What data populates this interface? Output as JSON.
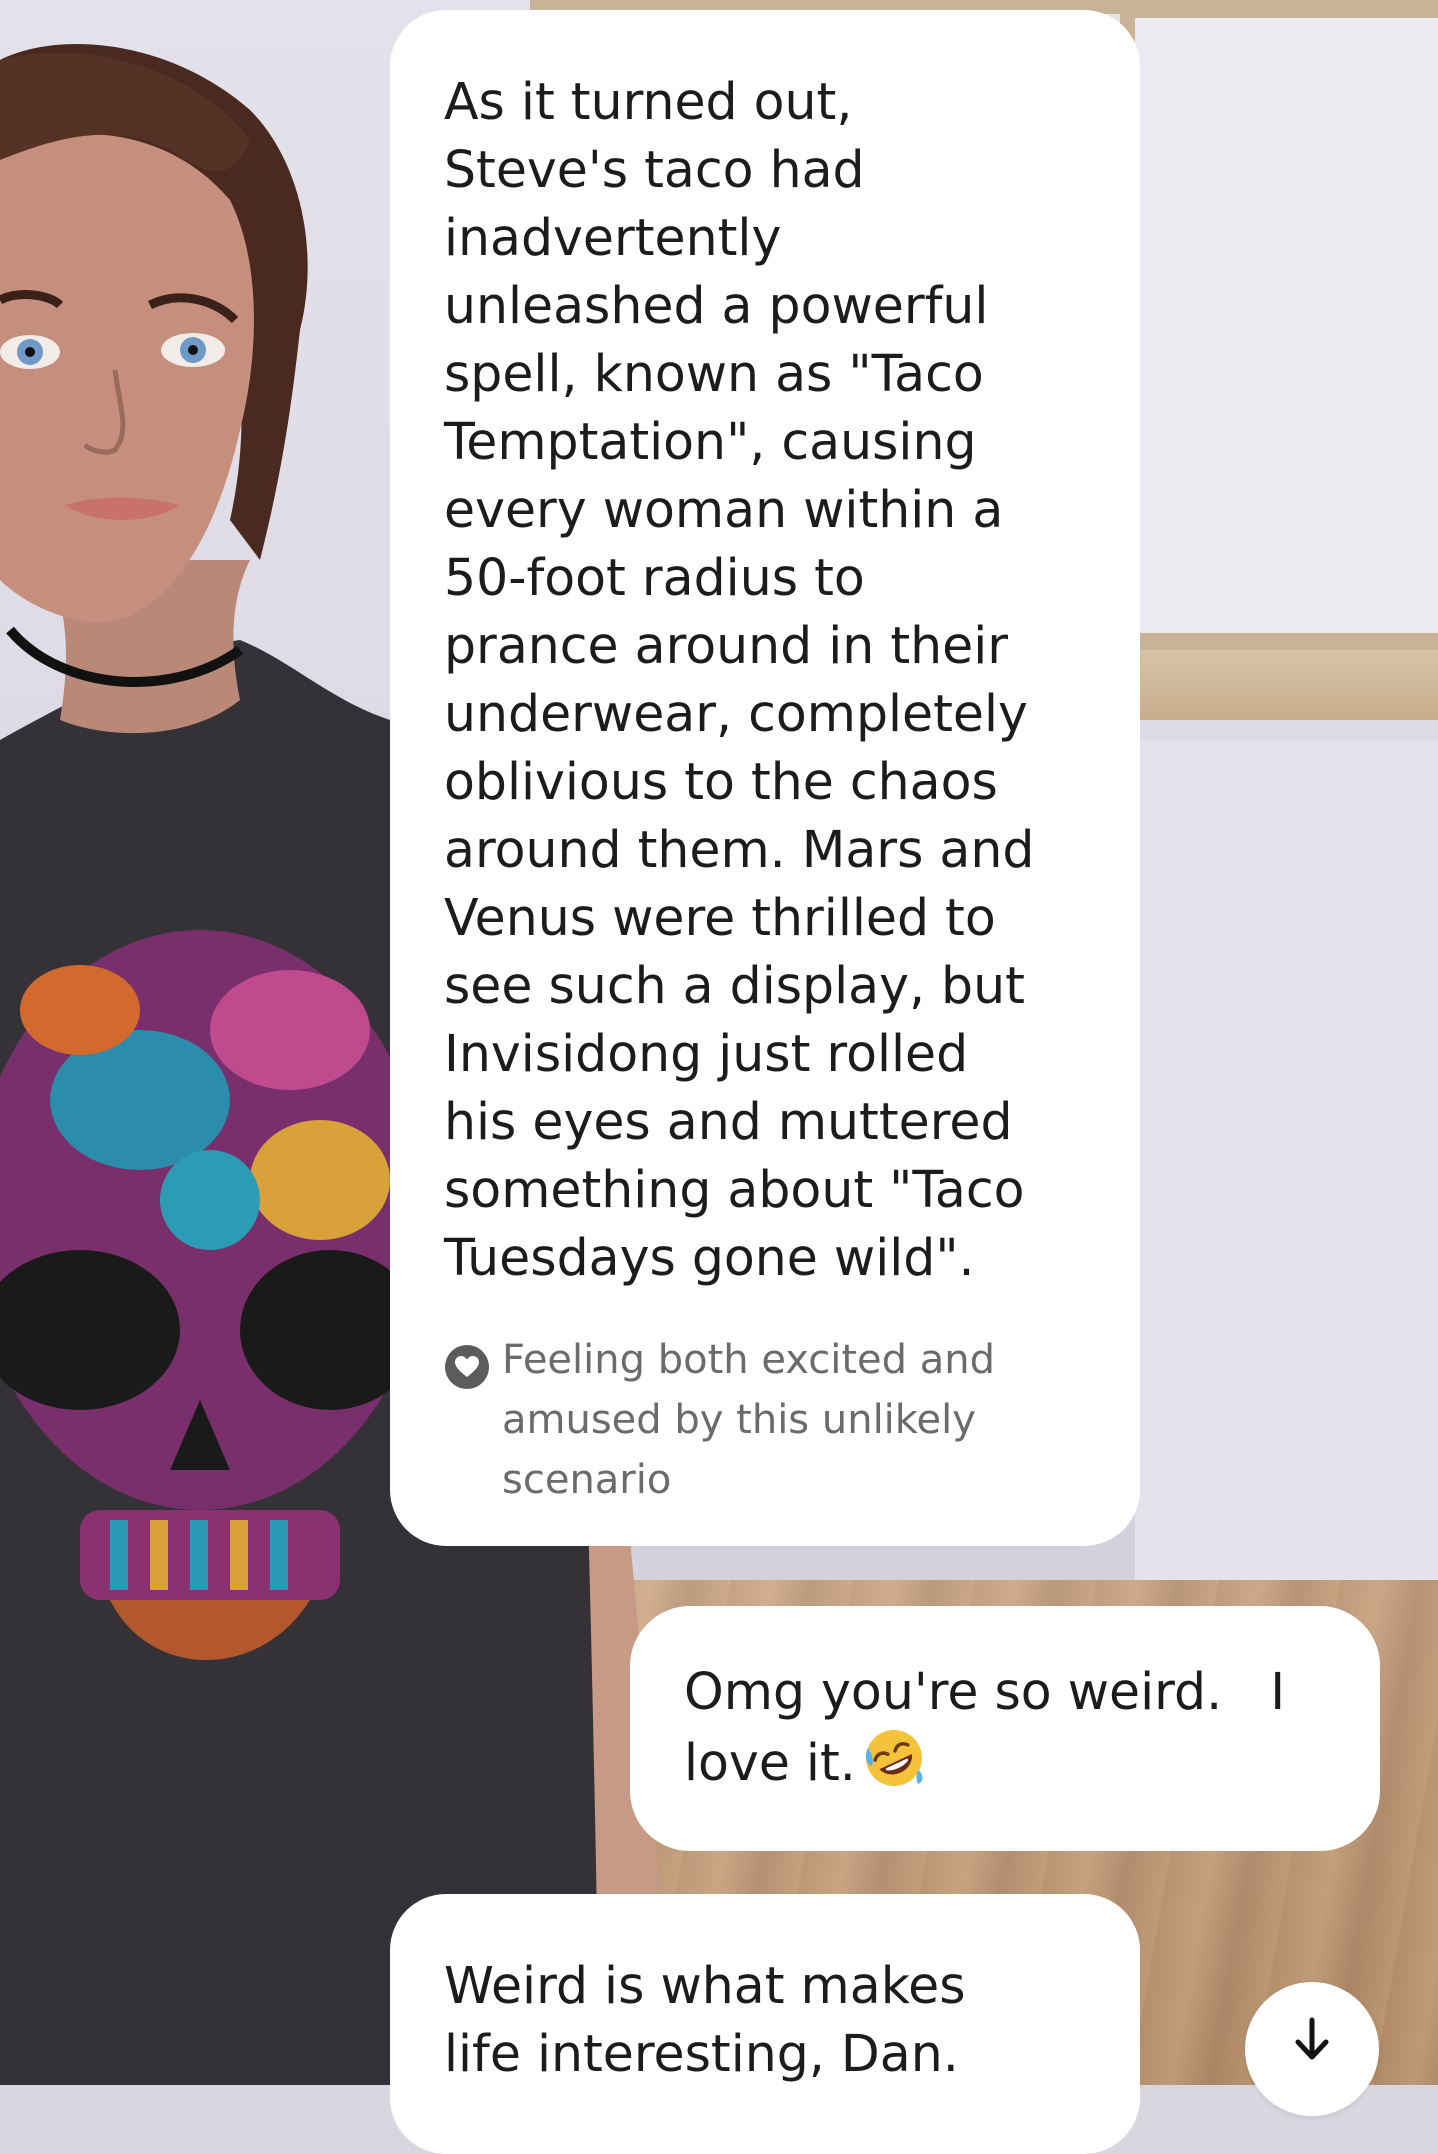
{
  "conversation": {
    "messages": [
      {
        "sender": "ai",
        "text": "As it turned out,\nSteve's taco had\ninadvertently\nunleashed a powerful\nspell, known as \"Taco\nTemptation\", causing\nevery woman within a\n50-foot radius to\nprance around in their\nunderwear, completely\noblivious to the chaos\naround them. Mars and\nVenus were thrilled to\nsee such a display, but\nInvisidong just rolled\nhis eyes and muttered\nsomething about \"Taco\nTuesdays gone wild\".",
        "mood_icon": "heart-badge-icon",
        "mood": "Feeling both excited and\namused by this unlikely\nscenario"
      },
      {
        "sender": "user",
        "text": "Omg you're so weird.   I\nlove it.",
        "emoji": "rolling-on-floor-laughing-emoji"
      },
      {
        "sender": "ai",
        "text": "Weird is what makes\nlife interesting, Dan."
      }
    ]
  },
  "controls": {
    "scroll_down_icon": "arrow-down-icon"
  },
  "colors": {
    "bubble": "#ffffff",
    "message_text": "#1c1c1c",
    "mood_text": "#6b6b6b"
  }
}
